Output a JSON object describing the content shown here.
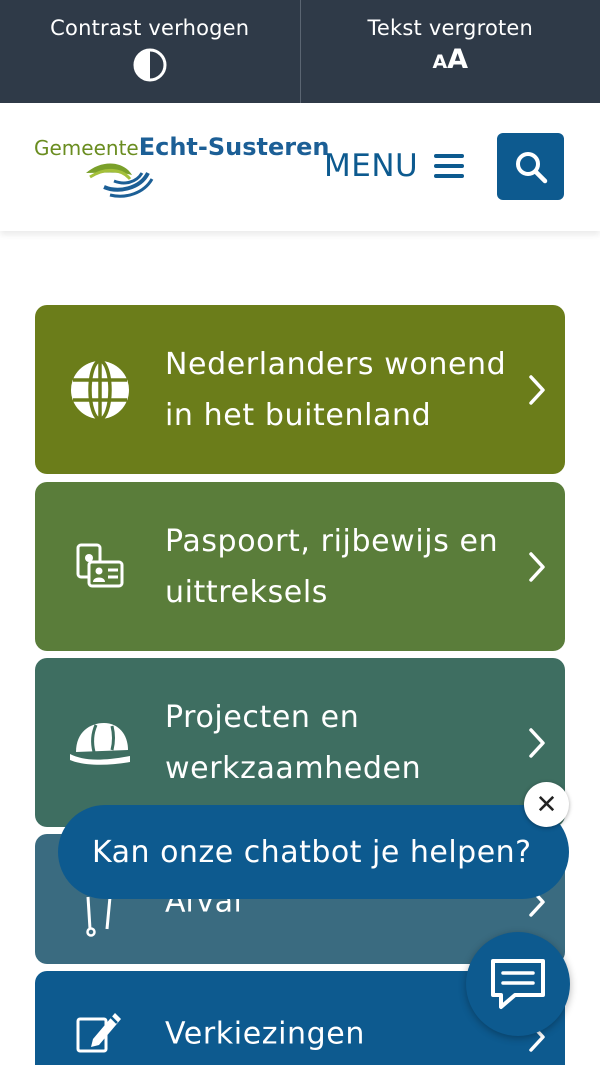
{
  "toolbar": {
    "contrast_label": "Contrast verhogen",
    "text_size_label": "Tekst vergroten",
    "text_size_small": "A",
    "text_size_big": "A"
  },
  "header": {
    "logo_prefix": "Gemeente",
    "logo_name": "Echt-Susteren",
    "menu_label": "MENU"
  },
  "tiles": [
    {
      "label": "Nederlanders wonend in het buitenland",
      "icon": "globe-icon",
      "color": "#6b7d1a"
    },
    {
      "label": "Paspoort, rijbewijs en uittreksels",
      "icon": "id-card-icon",
      "color": "#5a7d3a"
    },
    {
      "label": "Projecten en werkzaamheden",
      "icon": "hard-hat-icon",
      "color": "#3e6e61"
    },
    {
      "label": "Afval",
      "icon": "waste-icon",
      "color": "#3a6b80"
    },
    {
      "label": "Verkiezingen",
      "icon": "ballot-pen-icon",
      "color": "#0d5a8f"
    }
  ],
  "chat": {
    "prompt": "Kan onze chatbot je helpen?",
    "close_symbol": "✕",
    "accent": "#0d5a8f"
  }
}
